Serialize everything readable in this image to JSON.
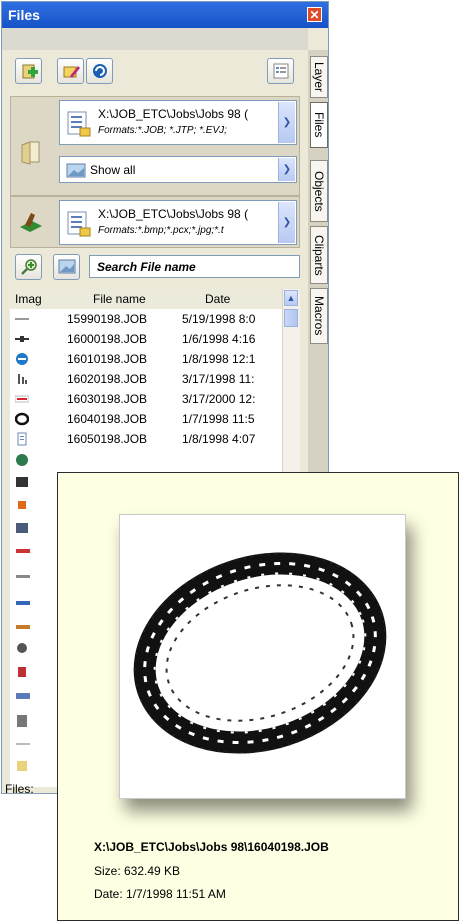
{
  "window": {
    "title": "Files",
    "close_label": "✕"
  },
  "tabs": [
    "Layer",
    "Files",
    "Objects",
    "Cliparts",
    "Macros"
  ],
  "toolbar": {
    "buttons": [
      "add-file",
      "edit",
      "refresh",
      "view-list"
    ]
  },
  "source1": {
    "path": "X:\\JOB_ETC\\Jobs\\Jobs 98 (",
    "formats": "Formats:*.JOB; *.JTP; *.EVJ;"
  },
  "filter": {
    "value": "Show all"
  },
  "source2": {
    "path": "X:\\JOB_ETC\\Jobs\\Jobs 98 (",
    "formats": "Formats:*.bmp;*.pcx;*.jpg;*.t"
  },
  "search": {
    "placeholder": "Search File name"
  },
  "list": {
    "columns": {
      "image": "Imag",
      "name": "File name",
      "date": "Date"
    },
    "rows": [
      {
        "name": "15990198.JOB",
        "date": "5/19/1998 8:0",
        "icon": "thin-bar"
      },
      {
        "name": "16000198.JOB",
        "date": "1/6/1998 4:16",
        "icon": "arrow"
      },
      {
        "name": "16010198.JOB",
        "date": "1/8/1998 12:1",
        "icon": "blue-circle"
      },
      {
        "name": "16020198.JOB",
        "date": "3/17/1998 11:",
        "icon": "pattern"
      },
      {
        "name": "16030198.JOB",
        "date": "3/17/2000 12:",
        "icon": "red-bar"
      },
      {
        "name": "16040198.JOB",
        "date": "1/7/1998 11:5",
        "icon": "ring"
      },
      {
        "name": "16050198.JOB",
        "date": "1/8/1998 4:07",
        "icon": "pattern"
      }
    ]
  },
  "status": {
    "text": "Files:"
  },
  "tooltip": {
    "path": "X:\\JOB_ETC\\Jobs\\Jobs 98\\16040198.JOB",
    "size": "Size: 632.49 KB",
    "date": "Date: 1/7/1998 11:51 AM"
  }
}
